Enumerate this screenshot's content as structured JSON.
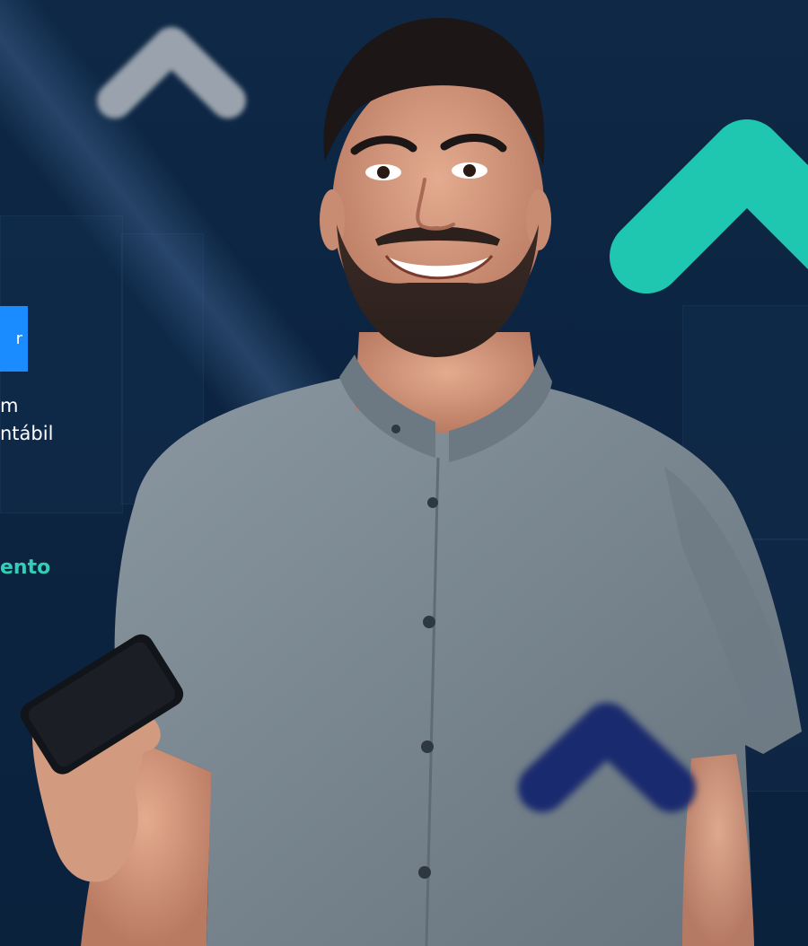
{
  "hero": {
    "tag_text": "r",
    "description_line_1": "m",
    "description_line_2": "ntábil",
    "cta_text": "ento"
  },
  "colors": {
    "background": "#0c2441",
    "accent_teal": "#1fc7b0",
    "accent_blue": "#1a8cff",
    "chevron_gray": "#9aa3ad",
    "chevron_navy": "#1a2a6e",
    "shirt_gray": "#7f8c96"
  },
  "icons": {
    "decor_1": "chevron-up-icon",
    "decor_2": "chevron-up-icon",
    "decor_3": "chevron-up-icon"
  }
}
